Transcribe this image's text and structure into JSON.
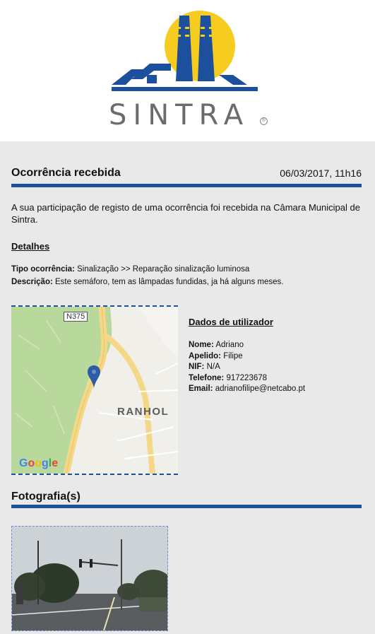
{
  "brand": {
    "logo_text": "SINTRA",
    "registered_mark": "®"
  },
  "header": {
    "title": "Ocorrência recebida",
    "date": "06/03/2017, 11h16"
  },
  "intro_text": "A sua participação de registo de uma ocorrência foi recebida na Câmara Municipal de Sintra.",
  "details": {
    "heading": "Detalhes",
    "type_label": "Tipo ocorrência:",
    "type_value": "Sinalização >> Reparação sinalização luminosa",
    "description_label": "Descrição:",
    "description_value": "Este semáforo, tem as lâmpadas fundidas, ja há alguns meses."
  },
  "map": {
    "road_label": "N375",
    "town_label": "RANHOL",
    "provider": "Google",
    "marker_icon": "map-pin-icon"
  },
  "user": {
    "heading": "Dados de utilizador",
    "name_label": "Nome:",
    "name_value": "Adriano",
    "surname_label": "Apelido:",
    "surname_value": "Filipe",
    "nif_label": "NIF:",
    "nif_value": "N/A",
    "phone_label": "Telefone:",
    "phone_value": "917223678",
    "email_label": "Email:",
    "email_value": "adrianofilipe@netcabo.pt"
  },
  "photos": {
    "heading": "Fotografia(s)"
  },
  "colors": {
    "accent": "#1c4f9c",
    "sun": "#f5cc1f",
    "panel_bg": "#e9e9e9"
  }
}
